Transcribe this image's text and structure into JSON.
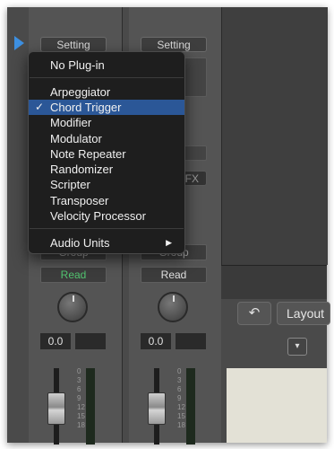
{
  "strip1": {
    "setting_label": "Setting",
    "automation": "Read",
    "automation_color": "#52c470",
    "pan_value": "0.0"
  },
  "strip2": {
    "setting_label": "Setting",
    "automation": "Read",
    "automation_color": "#e0e0e0",
    "pan_value": "0.0",
    "fx_partial": "FX",
    "group_partial": "Group"
  },
  "strip1_group_partial": "Group",
  "meter_scale": [
    "0",
    "3",
    "6",
    "9",
    "12",
    "15",
    "18"
  ],
  "menu": {
    "no_plugin": "No Plug-in",
    "items": [
      "Arpeggiator",
      "Chord Trigger",
      "Modifier",
      "Modulator",
      "Note Repeater",
      "Randomizer",
      "Scripter",
      "Transposer",
      "Velocity Processor"
    ],
    "selected": "Chord Trigger",
    "checkmark": "✓",
    "audio_units": "Audio Units",
    "submenu_arrow": "▶"
  },
  "toolbar": {
    "undo_icon": "↶",
    "layout_label": "Layout"
  },
  "colors": {
    "accent": "#2b5797",
    "read_active": "#52c470"
  }
}
